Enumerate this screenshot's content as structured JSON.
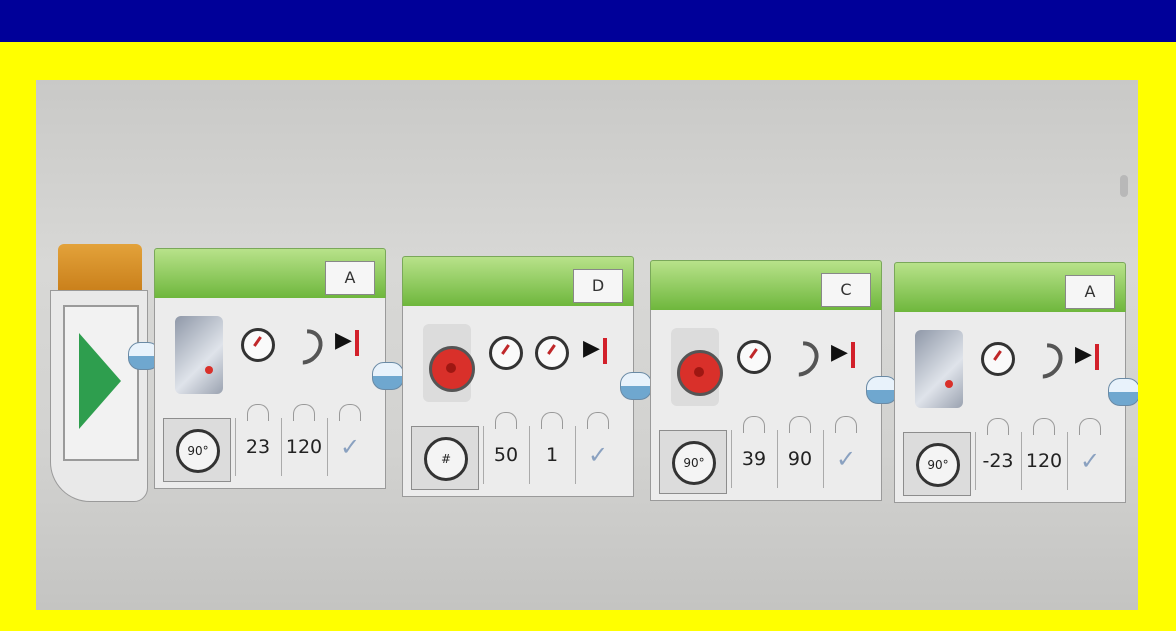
{
  "blocks": [
    {
      "port": "A",
      "motor_icon": "large-motor-icon",
      "mode_icon": "rotations-mode-icon",
      "mode_text": "90°",
      "power": "23",
      "amount": "120",
      "brake": "✓"
    },
    {
      "port": "D",
      "motor_icon": "medium-motor-icon",
      "mode_icon": "degrees-mode-icon",
      "mode_text": "#",
      "power": "50",
      "amount": "1",
      "brake": "✓"
    },
    {
      "port": "C",
      "motor_icon": "medium-motor-icon",
      "mode_icon": "rotations-mode-icon",
      "mode_text": "90°",
      "power": "39",
      "amount": "90",
      "brake": "✓"
    },
    {
      "port": "A",
      "motor_icon": "large-motor-icon",
      "mode_icon": "rotations-mode-icon",
      "mode_text": "90°",
      "power": "-23",
      "amount": "120",
      "brake": "✓"
    }
  ],
  "colors": {
    "frame": "#ffff00",
    "topbar": "#000099",
    "block_header": "#6db63b",
    "start_header": "#e3a23a",
    "play": "#2e9e4e"
  }
}
